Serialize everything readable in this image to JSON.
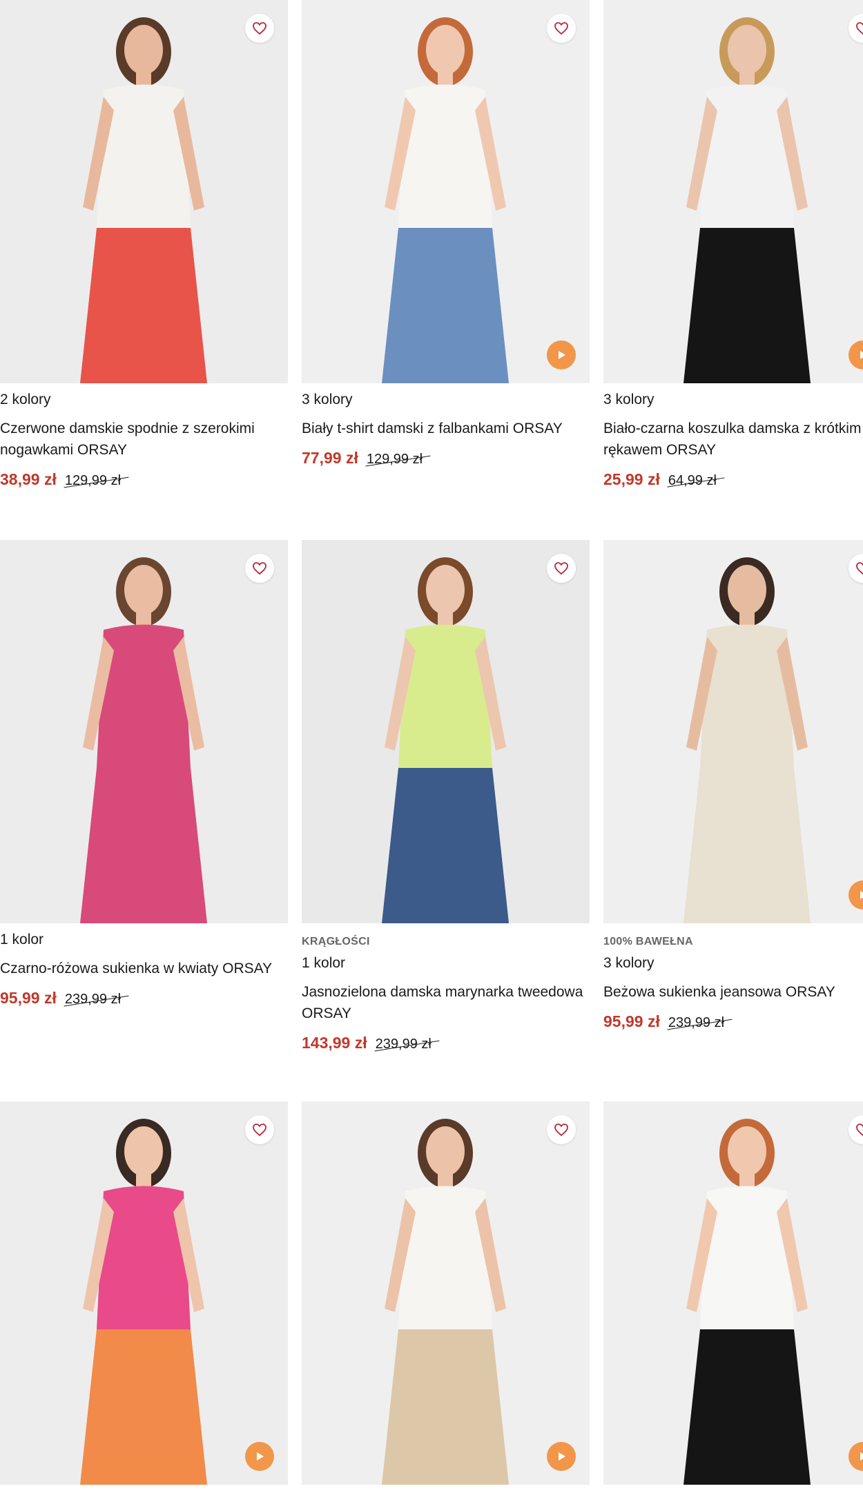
{
  "products": [
    {
      "colors": "2 kolory",
      "name": "Czerwone damskie spodnie z szerokimi nogawkami ORSAY",
      "price": "38,99 zł",
      "old_price": "129,99 zł",
      "badge": "",
      "video": false,
      "skin": "#e8b89c",
      "hair": "#5a3a28",
      "top": "#f4f2ef",
      "bottom": "#e8544a",
      "bg": "#ececec",
      "icons": {
        "wishlist": "heart-icon",
        "video": "play-icon"
      }
    },
    {
      "colors": "3 kolory",
      "name": "Biały t-shirt damski z falbankami ORSAY",
      "price": "77,99 zł",
      "old_price": "129,99 zł",
      "badge": "",
      "video": true,
      "skin": "#f0c8b0",
      "hair": "#c46a3a",
      "top": "#f7f5f2",
      "bottom": "#6b8fbf",
      "bg": "#efefef"
    },
    {
      "colors": "3 kolory",
      "name": "Biało-czarna koszulka damska z krótkim rękawem ORSAY",
      "price": "25,99 zł",
      "old_price": "64,99 zł",
      "badge": "",
      "video": true,
      "skin": "#eac4ac",
      "hair": "#c89a5a",
      "top": "#f2f2f2",
      "bottom": "#151515",
      "bg": "#efefef"
    },
    {
      "colors": "1 kolor",
      "name": "Czarno-różowa sukienka w kwiaty ORSAY",
      "price": "95,99 zł",
      "old_price": "239,99 zł",
      "badge": "",
      "video": false,
      "skin": "#eabca2",
      "hair": "#6a4530",
      "top": "#d84a7a",
      "bottom": "#d84a7a",
      "bg": "#ececec"
    },
    {
      "colors": "1 kolor",
      "name": "Jasnozielona damska marynarka tweedowa ORSAY",
      "price": "143,99 zł",
      "old_price": "239,99 zł",
      "badge": "KRĄGŁOŚCI",
      "video": false,
      "skin": "#ecc6ae",
      "hair": "#7a4a2a",
      "top": "#d8ec8e",
      "bottom": "#3c5a8a",
      "bg": "#e9e9e9"
    },
    {
      "colors": "3 kolory",
      "name": "Beżowa sukienka jeansowa ORSAY",
      "price": "95,99 zł",
      "old_price": "239,99 zł",
      "badge": "100% BAWEŁNA",
      "video": true,
      "skin": "#e6bca0",
      "hair": "#3a2a22",
      "top": "#e8e0d0",
      "bottom": "#e8e0d0",
      "bg": "#efefef"
    },
    {
      "colors": "",
      "name": "",
      "price": "",
      "old_price": "",
      "badge": "",
      "video": true,
      "skin": "#eec4aa",
      "hair": "#3a2a24",
      "top": "#e84a8a",
      "bottom": "#f28a4a",
      "bg": "#ededed"
    },
    {
      "colors": "",
      "name": "",
      "price": "",
      "old_price": "",
      "badge": "",
      "video": true,
      "skin": "#ecc2a8",
      "hair": "#5a3a28",
      "top": "#f7f5f2",
      "bottom": "#dcc7a8",
      "bg": "#efefef"
    },
    {
      "colors": "",
      "name": "",
      "price": "",
      "old_price": "",
      "badge": "",
      "video": true,
      "skin": "#f0c8ae",
      "hair": "#c46a3a",
      "top": "#f7f7f5",
      "bottom": "#151515",
      "bg": "#efefef"
    }
  ]
}
